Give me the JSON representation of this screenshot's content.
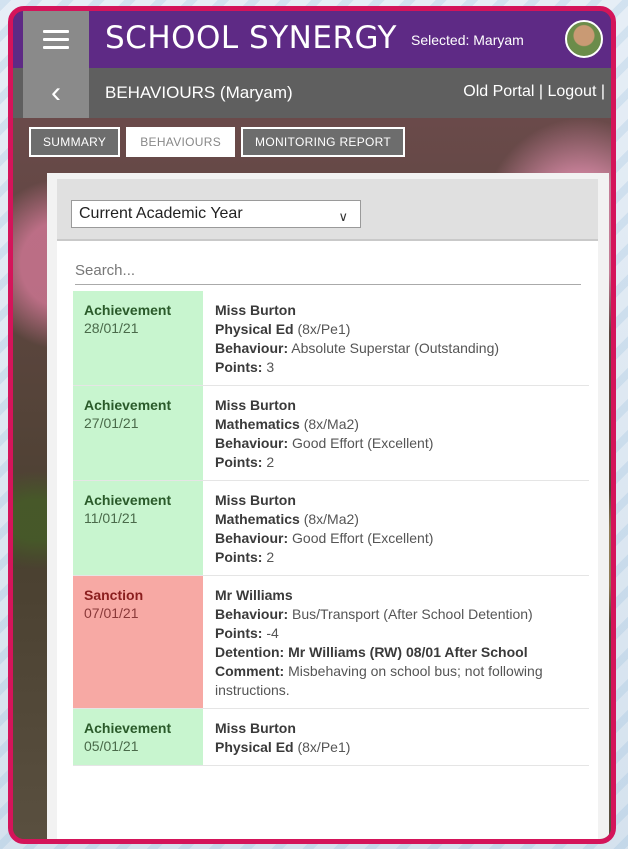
{
  "app": {
    "brand": "SCHOOL SYNERGY",
    "selected": "Selected: Maryam",
    "page_title": "BEHAVIOURS (Maryam)",
    "links": {
      "old_portal": "Old Portal",
      "separator": "|",
      "logout": "Logout",
      "trailing": "|"
    }
  },
  "tabs": [
    {
      "label": "SUMMARY",
      "active": false
    },
    {
      "label": "BEHAVIOURS",
      "active": true
    },
    {
      "label": "MONITORING REPORT",
      "active": false
    }
  ],
  "filter": {
    "selected": "Current Academic Year"
  },
  "search": {
    "placeholder": "Search..."
  },
  "records": [
    {
      "type": "Achievement",
      "date": "28/01/21",
      "teacher": "Miss Burton",
      "subject": "Physical Ed",
      "class": "(8x/Pe1)",
      "behaviour_label": "Behaviour:",
      "behaviour": "Absolute Superstar (Outstanding)",
      "points_label": "Points:",
      "points": "3"
    },
    {
      "type": "Achievement",
      "date": "27/01/21",
      "teacher": "Miss Burton",
      "subject": "Mathematics",
      "class": "(8x/Ma2)",
      "behaviour_label": "Behaviour:",
      "behaviour": "Good Effort (Excellent)",
      "points_label": "Points:",
      "points": "2"
    },
    {
      "type": "Achievement",
      "date": "11/01/21",
      "teacher": "Miss Burton",
      "subject": "Mathematics",
      "class": "(8x/Ma2)",
      "behaviour_label": "Behaviour:",
      "behaviour": "Good Effort (Excellent)",
      "points_label": "Points:",
      "points": "2"
    },
    {
      "type": "Sanction",
      "date": "07/01/21",
      "teacher": "Mr Williams",
      "behaviour_label": "Behaviour:",
      "behaviour": "Bus/Transport (After School Detention)",
      "points_label": "Points:",
      "points": "-4",
      "detention": "Detention: Mr Williams (RW) 08/01 After School",
      "comment_label": "Comment:",
      "comment": "Misbehaving on school bus; not following instructions."
    },
    {
      "type": "Achievement",
      "date": "05/01/21",
      "teacher": "Miss Burton",
      "subject": "Physical Ed",
      "class": "(8x/Pe1)"
    }
  ],
  "colors": {
    "frame": "#d4145a",
    "header": "#5e2a85",
    "subheader": "#5f5f5f",
    "achievement": "#c8f5cf",
    "sanction": "#f7a9a4"
  }
}
